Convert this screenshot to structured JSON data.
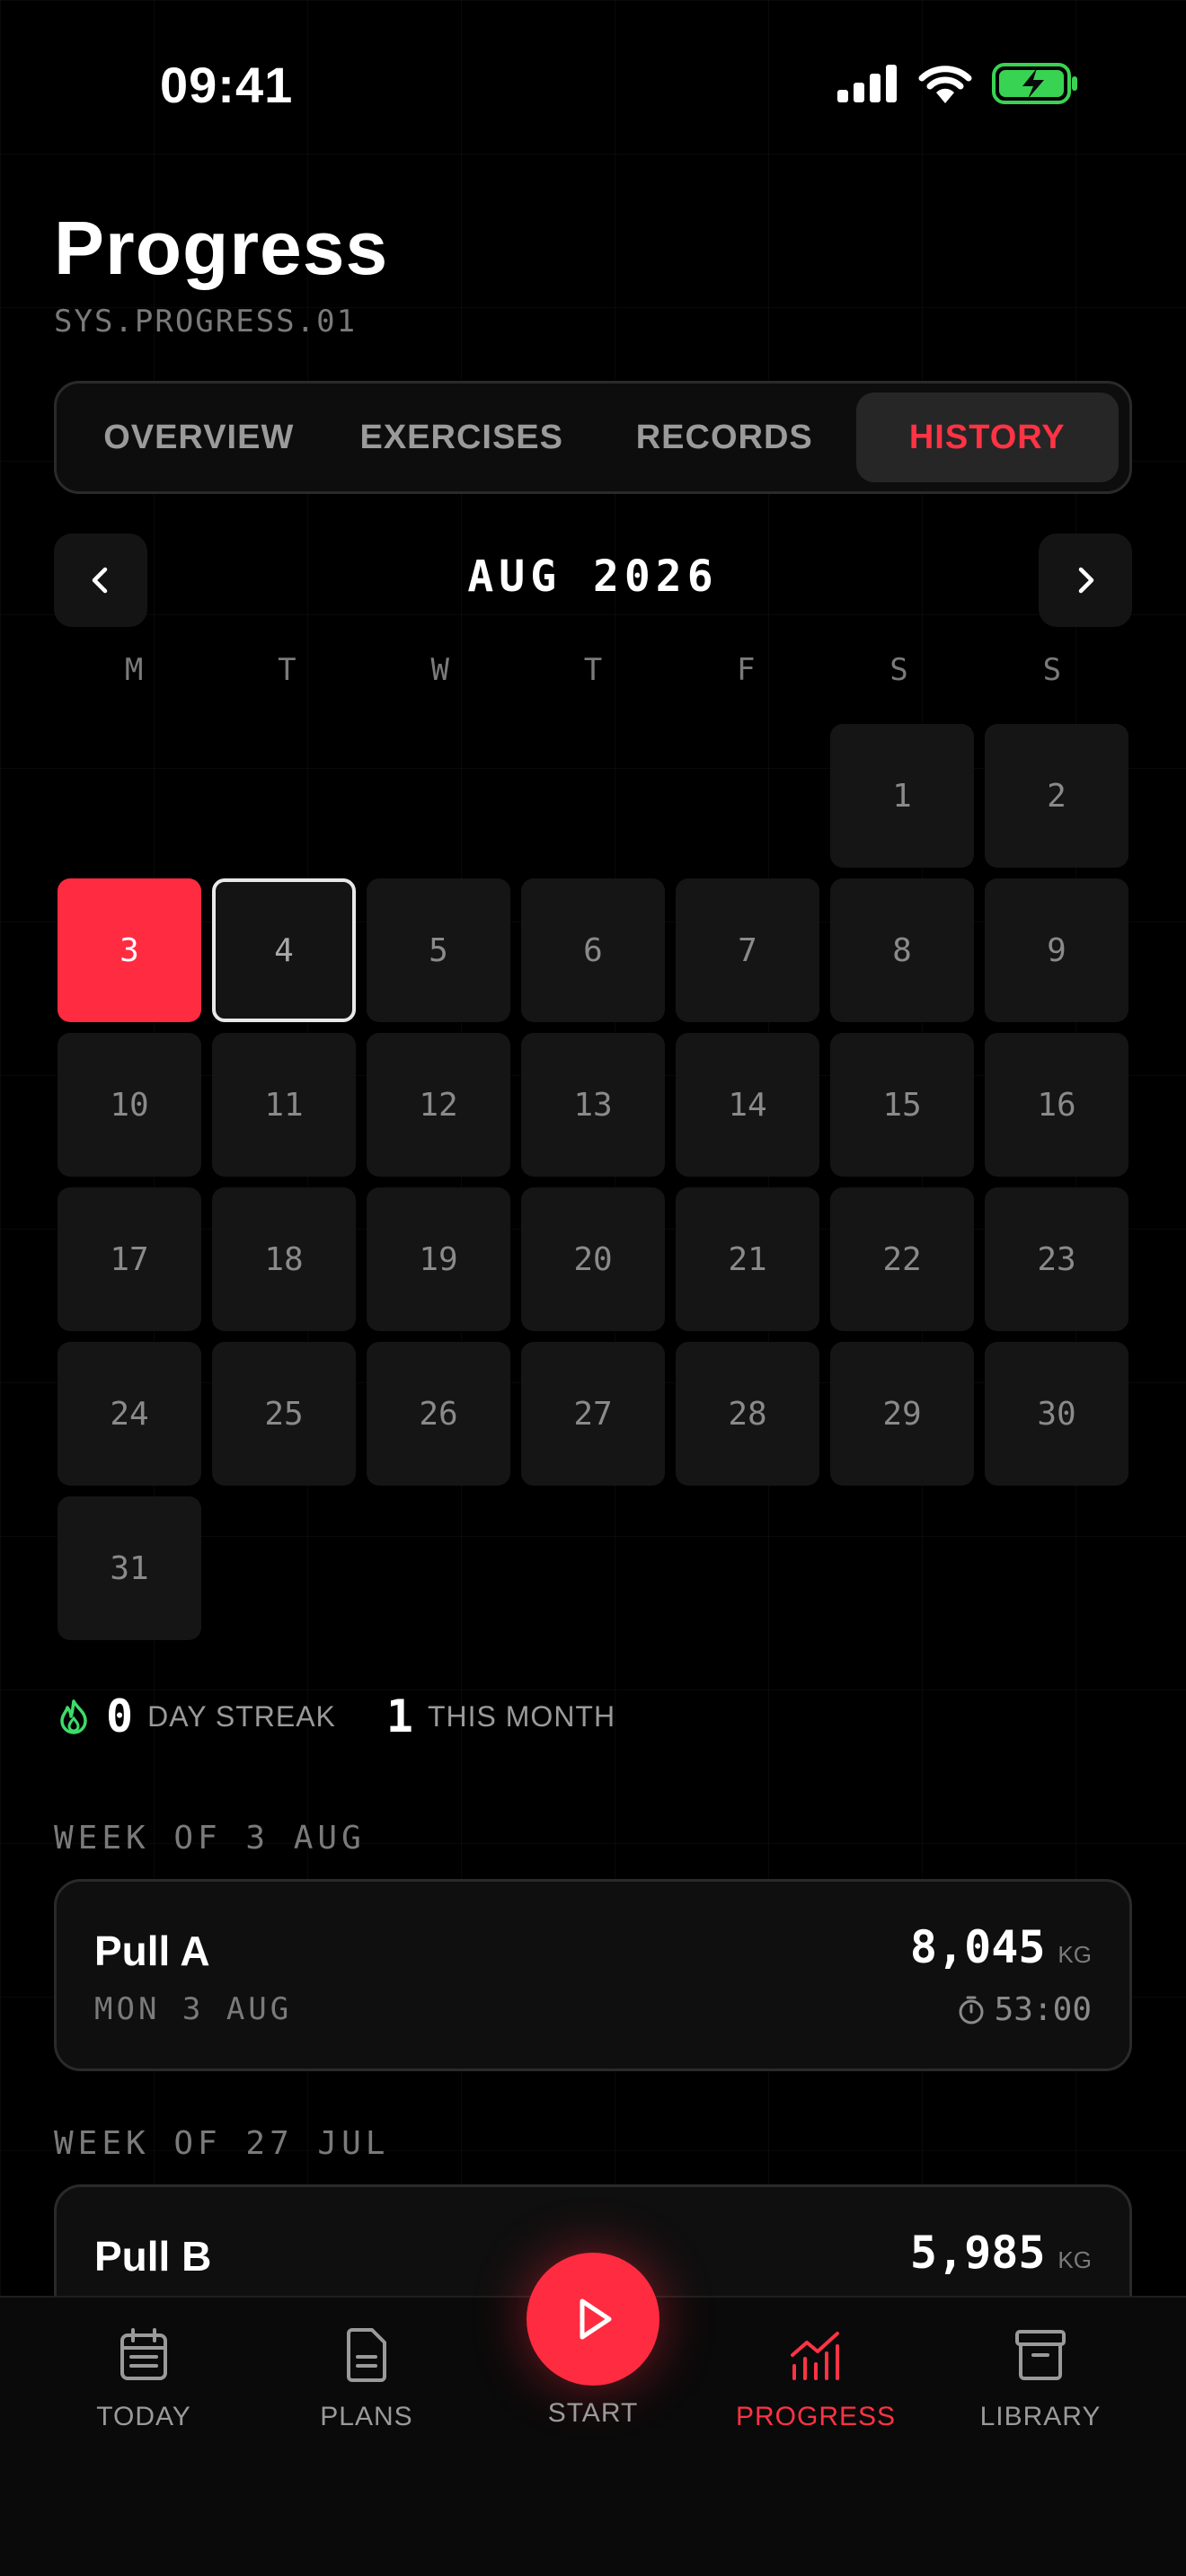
{
  "status_bar": {
    "time": "09:41"
  },
  "header": {
    "title": "Progress",
    "subtitle": "SYS.PROGRESS.01"
  },
  "tabs": [
    {
      "label": "OVERVIEW",
      "active": false
    },
    {
      "label": "EXERCISES",
      "active": false
    },
    {
      "label": "RECORDS",
      "active": false
    },
    {
      "label": "HISTORY",
      "active": true
    }
  ],
  "calendar": {
    "month_label": "AUG 2026",
    "weekdays": [
      "M",
      "T",
      "W",
      "T",
      "F",
      "S",
      "S"
    ],
    "leading_empty_days": 5,
    "days": [
      "1",
      "2",
      "3",
      "4",
      "5",
      "6",
      "7",
      "8",
      "9",
      "10",
      "11",
      "12",
      "13",
      "14",
      "15",
      "16",
      "17",
      "18",
      "19",
      "20",
      "21",
      "22",
      "23",
      "24",
      "25",
      "26",
      "27",
      "28",
      "29",
      "30",
      "31"
    ],
    "workout_days": [
      "3"
    ],
    "today": "4"
  },
  "streak": {
    "streak_value": "0",
    "streak_label": "DAY STREAK",
    "month_value": "1",
    "month_label": "THIS MONTH"
  },
  "weeks": [
    {
      "label": "WEEK OF 3 AUG",
      "session": {
        "name": "Pull A",
        "date": "MON 3 AUG",
        "volume": "8,045",
        "unit": "KG",
        "duration": "53:00"
      }
    },
    {
      "label": "WEEK OF 27 JUL",
      "session": {
        "name": "Pull B",
        "volume": "5,985",
        "unit": "KG"
      }
    }
  ],
  "bottom_nav": {
    "today": "TODAY",
    "plans": "PLANS",
    "start": "START",
    "progress": "PROGRESS",
    "library": "LIBRARY"
  },
  "colors": {
    "accent": "#ff2b40",
    "background": "#000000",
    "streak_icon": "#3ddc6a",
    "battery": "#39d353"
  },
  "icons": {
    "status": [
      "signal-icon",
      "wifi-icon",
      "battery-charging-icon"
    ],
    "month_nav": [
      "chevron-left-icon",
      "chevron-right-icon"
    ],
    "streak": "flame-icon",
    "duration": "stopwatch-icon",
    "nav": [
      "calendar-icon",
      "document-icon",
      "play-icon",
      "chart-icon",
      "archive-icon"
    ]
  }
}
